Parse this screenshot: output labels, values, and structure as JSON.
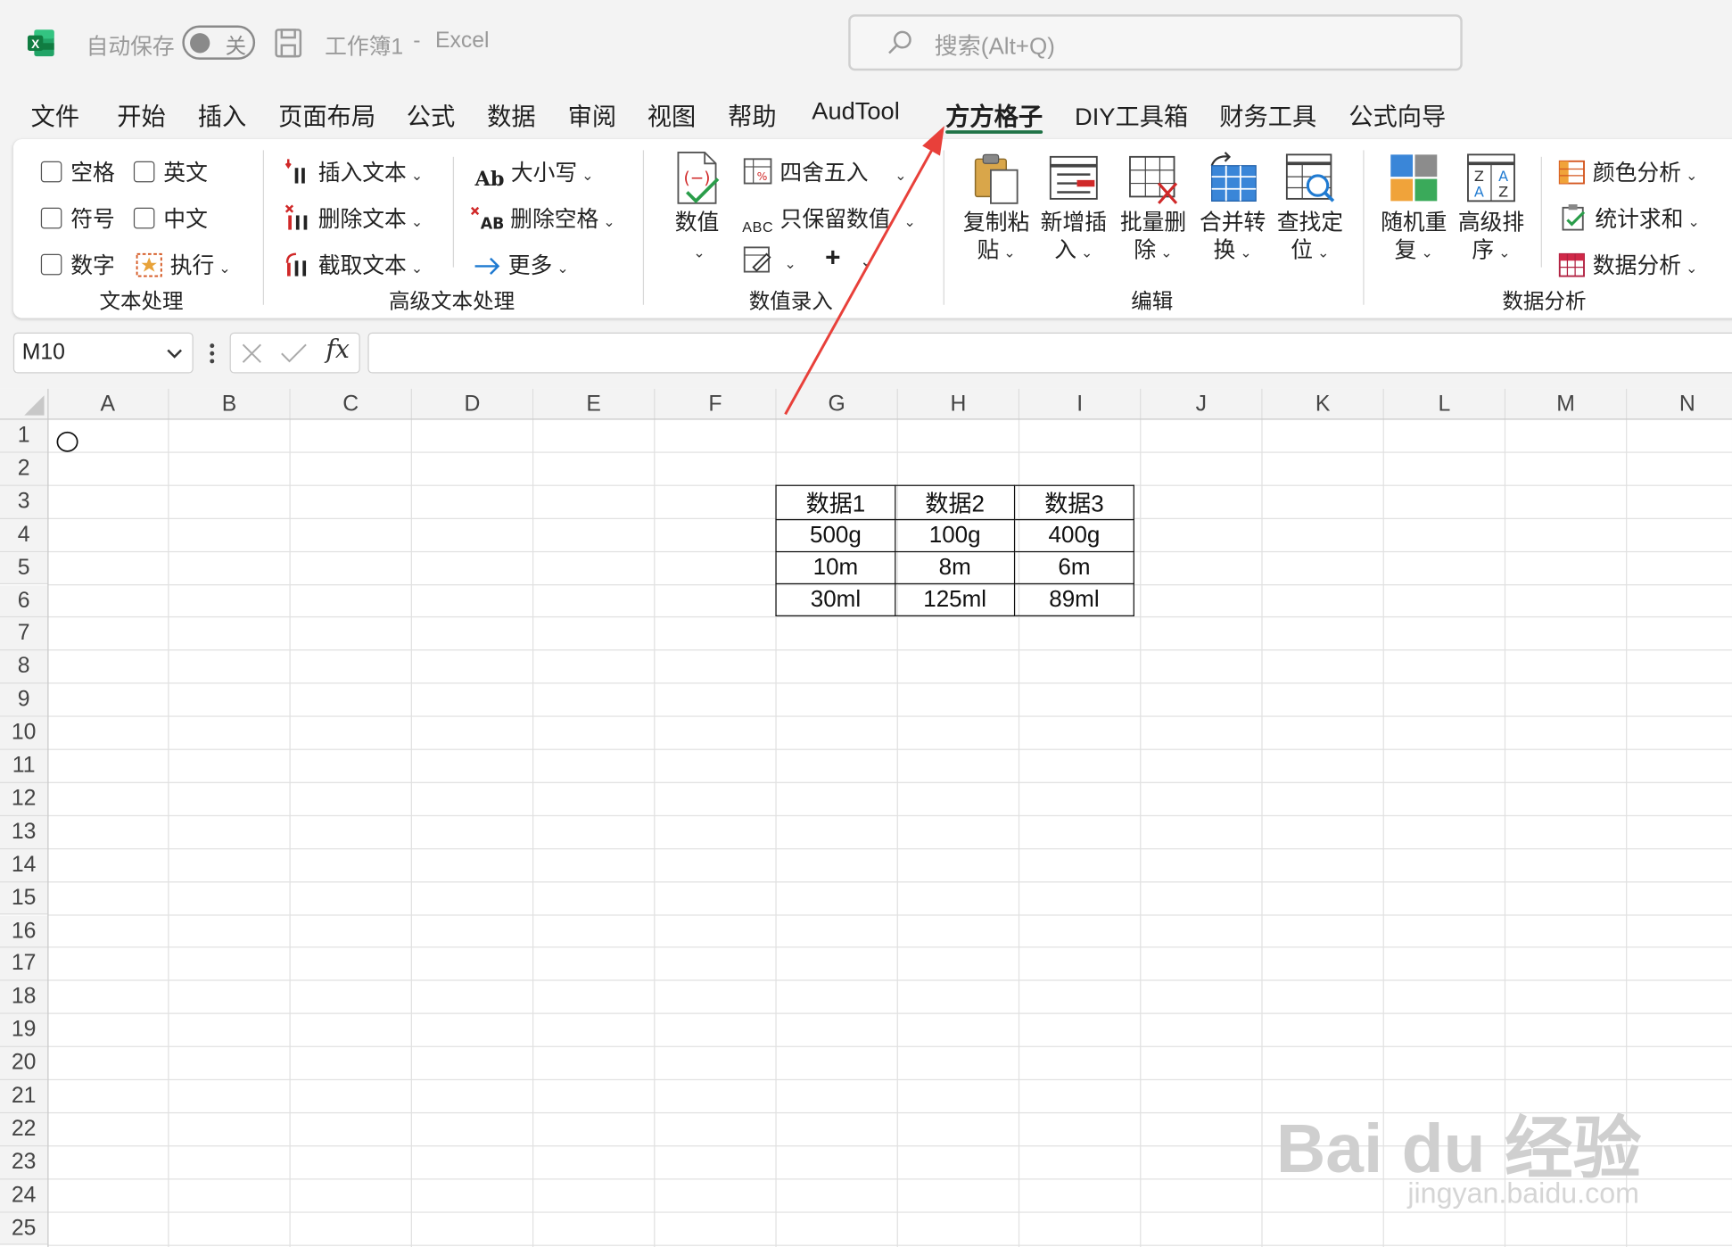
{
  "titlebar": {
    "autosave_label": "自动保存",
    "autosave_state": "关",
    "workbook_name": "工作簿1",
    "separator": "-",
    "app_name": "Excel",
    "search_placeholder": "搜索(Alt+Q)"
  },
  "menu": {
    "items": [
      "文件",
      "开始",
      "插入",
      "页面布局",
      "公式",
      "数据",
      "审阅",
      "视图",
      "帮助",
      "AudTool",
      "方方格子",
      "DIY工具箱",
      "财务工具",
      "公式向导"
    ],
    "active": "方方格子"
  },
  "ribbon": {
    "text_processing": {
      "label": "文本处理",
      "checkboxes": [
        "空格",
        "英文",
        "符号",
        "中文",
        "数字"
      ],
      "execute": "执行"
    },
    "advanced_text": {
      "label": "高级文本处理",
      "insert_text": "插入文本",
      "delete_text": "删除文本",
      "extract_text": "截取文本",
      "case": "大小写",
      "delete_space": "删除空格",
      "more": "更多"
    },
    "value_entry": {
      "label": "数值录入",
      "value": "数值",
      "round": "四舍五入",
      "keep_values": "只保留数值"
    },
    "edit": {
      "label": "编辑",
      "copy_paste": [
        "复制粘",
        "贴"
      ],
      "insert_new": [
        "新增插",
        "入"
      ],
      "batch_delete": [
        "批量删",
        "除"
      ],
      "merge_convert": [
        "合并转",
        "换"
      ],
      "find_locate": [
        "查找定",
        "位"
      ]
    },
    "data_analysis": {
      "label": "数据分析",
      "random_repeat": [
        "随机重",
        "复"
      ],
      "advanced_sort": [
        "高级排",
        "序"
      ],
      "color_analysis": "颜色分析",
      "stat_sum": "统计求和",
      "data_analysis": "数据分析"
    }
  },
  "formula_bar": {
    "name_box": "M10",
    "fx": "fx",
    "formula": ""
  },
  "sheet": {
    "columns": [
      "A",
      "B",
      "C",
      "D",
      "E",
      "F",
      "G",
      "H",
      "I",
      "J",
      "K",
      "L",
      "M",
      "N"
    ],
    "rows": [
      "1",
      "2",
      "3",
      "4",
      "5",
      "6",
      "7",
      "8",
      "9",
      "10",
      "11",
      "12",
      "13",
      "14",
      "15",
      "16",
      "17",
      "18",
      "19",
      "20",
      "21",
      "22",
      "23",
      "24",
      "25"
    ],
    "table": [
      [
        "数据1",
        "数据2",
        "数据3"
      ],
      [
        "500g",
        "100g",
        "400g"
      ],
      [
        "10m",
        "8m",
        "6m"
      ],
      [
        "30ml",
        "125ml",
        "89ml"
      ]
    ]
  },
  "watermark": {
    "text": "Bai du 经验",
    "url": "jingyan.baidu.com"
  },
  "colors": {
    "excel_green": "#1e7145",
    "annotation_arrow": "#e8403a"
  }
}
